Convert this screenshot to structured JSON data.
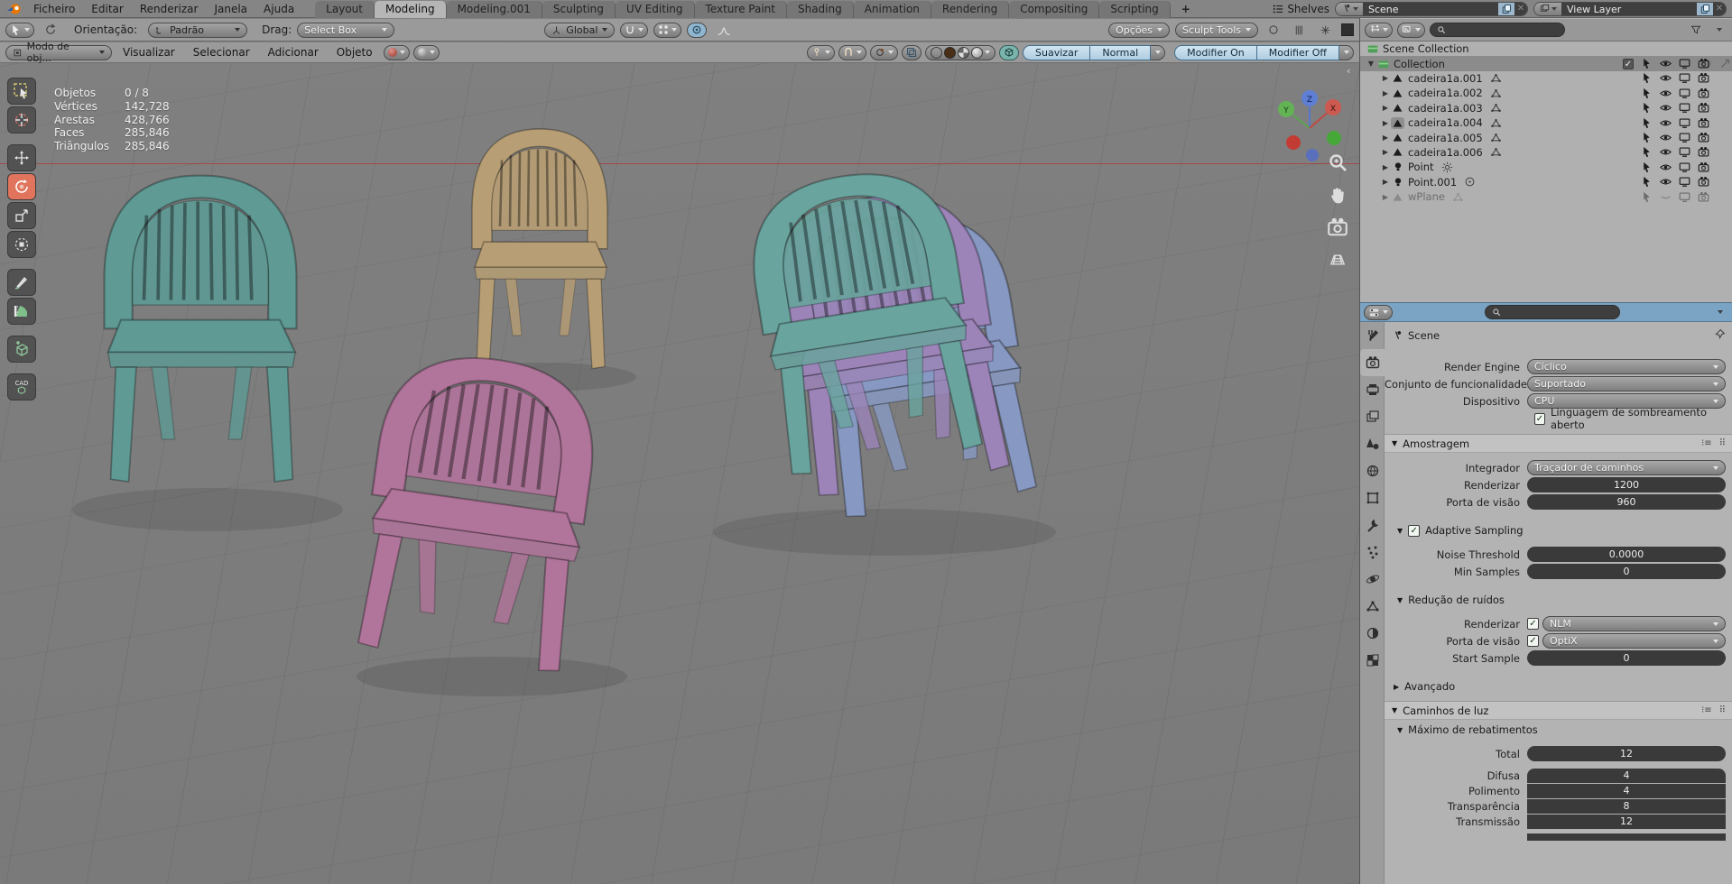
{
  "topbar": {
    "menus": [
      "Ficheiro",
      "Editar",
      "Renderizar",
      "Janela",
      "Ajuda"
    ],
    "tabs": [
      "Layout",
      "Modeling",
      "Modeling.001",
      "Sculpting",
      "UV Editing",
      "Texture Paint",
      "Shading",
      "Animation",
      "Rendering",
      "Compositing",
      "Scripting"
    ],
    "active_tab": "Modeling",
    "add_tab": "+",
    "shelves_label": "Shelves",
    "scene_field": "Scene",
    "view_layer_field": "View Layer"
  },
  "tool_header": {
    "orientation_label": "Orientação:",
    "orientation_value": "Padrão",
    "drag_label": "Drag:",
    "drag_value": "Select Box",
    "transform_value": "Global",
    "options_label": "Opções",
    "sculpt_tools_label": "Sculpt Tools"
  },
  "viewport_header": {
    "mode_value": "Modo de obj...",
    "menus": [
      "Visualizar",
      "Selecionar",
      "Adicionar",
      "Objeto"
    ],
    "smooth_label": "Suavizar",
    "normal_label": "Normal",
    "modifier_on_label": "Modifier On",
    "modifier_off_label": "Modifier Off"
  },
  "stats": {
    "rows": [
      {
        "label": "Objetos",
        "value": "0 / 8"
      },
      {
        "label": "Vértices",
        "value": "142,728"
      },
      {
        "label": "Arestas",
        "value": "428,766"
      },
      {
        "label": "Faces",
        "value": "285,846"
      },
      {
        "label": "Triângulos",
        "value": "285,846"
      }
    ]
  },
  "gizmo": {
    "x": "X",
    "y": "Y",
    "z": "Z"
  },
  "outliner": {
    "root": "Scene Collection",
    "collection": "Collection",
    "rows": [
      {
        "name": "cadeira1a.001"
      },
      {
        "name": "cadeira1a.002"
      },
      {
        "name": "cadeira1a.003"
      },
      {
        "name": "cadeira1a.004"
      },
      {
        "name": "cadeira1a.005"
      },
      {
        "name": "cadeira1a.006"
      },
      {
        "name": "Point"
      },
      {
        "name": "Point.001"
      },
      {
        "name": "wPlane"
      }
    ]
  },
  "properties": {
    "breadcrumb": "Scene",
    "render": {
      "engine_label": "Render Engine",
      "engine_value": "Cíclico",
      "featureset_label": "Conjunto de funcionalidades",
      "featureset_value": "Suportado",
      "device_label": "Dispositivo",
      "device_value": "CPU",
      "osl_label": "Linguagem de sombreamento aberto"
    },
    "sampling": {
      "title": "Amostragem",
      "integrator_label": "Integrador",
      "integrator_value": "Traçador de caminhos",
      "render_label": "Renderizar",
      "render_value": "1200",
      "viewport_label": "Porta de visão",
      "viewport_value": "960",
      "adaptive_title": "Adaptive Sampling",
      "noise_label": "Noise Threshold",
      "noise_value": "0.0000",
      "min_label": "Min Samples",
      "min_value": "0",
      "denoise_title": "Redução de ruídos",
      "denoise_render_label": "Renderizar",
      "denoise_render_value": "NLM",
      "denoise_viewport_label": "Porta de visão",
      "denoise_viewport_value": "OptiX",
      "start_sample_label": "Start Sample",
      "start_sample_value": "0",
      "advanced_title": "Avançado"
    },
    "light_paths": {
      "title": "Caminhos de luz",
      "bounces_title": "Máximo de rebatimentos",
      "total_label": "Total",
      "total_value": "12",
      "diffuse_label": "Difusa",
      "diffuse_value": "4",
      "glossy_label": "Polimento",
      "glossy_value": "4",
      "transparency_label": "Transparência",
      "transparency_value": "8",
      "transmission_label": "Transmissão",
      "transmission_value": "12"
    }
  },
  "colors": {
    "accent_header_blue": "#7ba3c3",
    "tool_active": "#e0745c",
    "chair_teal": "#5f9a94",
    "chair_tan": "#b79e74",
    "chair_pink": "#b1749b",
    "chair_purple": "#9c84b8",
    "chair_blue": "#8799c2",
    "axis_red": "#aa3e3e"
  }
}
